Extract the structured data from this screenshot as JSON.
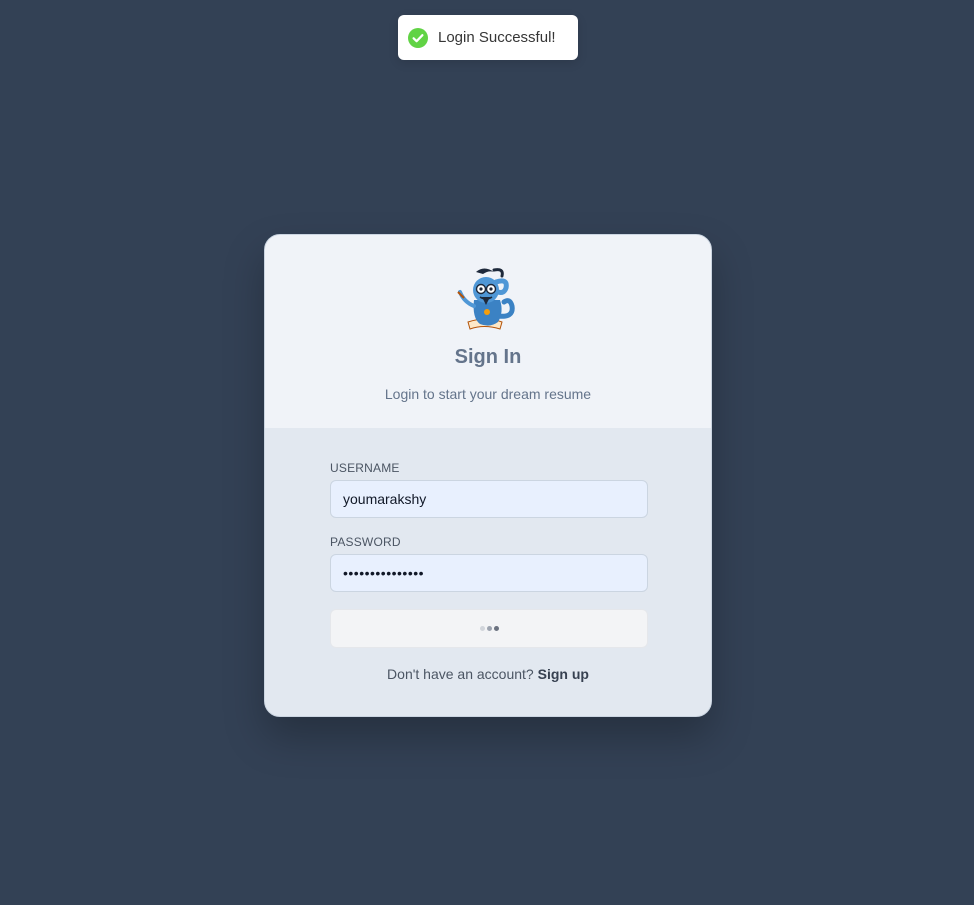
{
  "toast": {
    "icon": "check-circle-icon",
    "message": "Login Successful!",
    "accent_color": "#61d345"
  },
  "login_card": {
    "logo": "genie-mascot-logo",
    "title": "Sign In",
    "subtitle": "Login to start your dream resume",
    "username": {
      "label": "USERNAME",
      "value": "youmarakshy"
    },
    "password": {
      "label": "PASSWORD",
      "value": "•••••••••••••••"
    },
    "submit_button": {
      "state": "loading",
      "icon": "loading-dots-icon"
    },
    "signup_prompt": "Don't have an account?",
    "signup_link": "Sign up"
  },
  "colors": {
    "background": "#334155",
    "card_header": "#f0f3f8",
    "card_body": "#e2e8f0",
    "input_fill": "#e8f0fe",
    "title_text": "#64748b"
  }
}
